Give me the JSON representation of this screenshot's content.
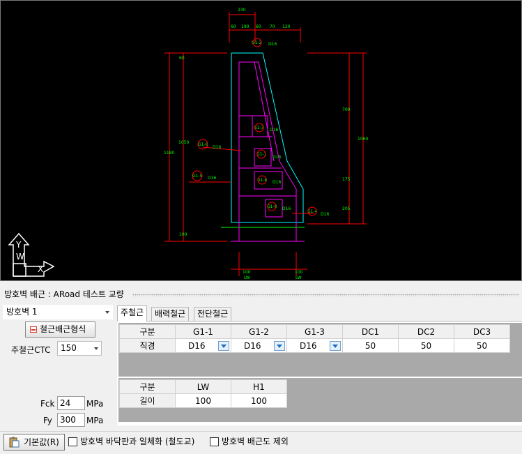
{
  "cad": {
    "dims_top": [
      "230",
      "60",
      "190",
      "60",
      "70",
      "120"
    ],
    "dims_left": [
      "60",
      "1180",
      "1050",
      "100"
    ],
    "dims_right": [
      "700",
      "1060",
      "175",
      "205"
    ],
    "dims_bottom": [
      "100",
      "LW",
      "100",
      "LW"
    ],
    "rebar_tags": [
      "G1-2",
      "D16",
      "G1-3",
      "D16",
      "G1-8",
      "D16",
      "G1-1",
      "D16",
      "G1-9",
      "D16",
      "G1-6",
      "D16",
      "G1-8",
      "D16",
      "G1-4",
      "D16",
      "G1-1",
      "D16",
      "G1-5",
      "D16"
    ],
    "axis_labels": [
      "W",
      "Y",
      "X"
    ]
  },
  "panel": {
    "title": "방호벽 배근 : ARoad 테스트 교량"
  },
  "left": {
    "wall_select": "방호벽 1",
    "rebar_form_button": "철근배근형식",
    "ctc_label": "주철근CTC",
    "ctc_value": "150",
    "fck_label": "Fck",
    "fck_value": "24",
    "fck_unit": "MPa",
    "fy_label": "Fy",
    "fy_value": "300",
    "fy_unit": "MPa"
  },
  "tabs": [
    "주철근",
    "배력철근",
    "전단철근"
  ],
  "main_table": {
    "headers": [
      "구분",
      "G1-1",
      "G1-2",
      "G1-3",
      "DC1",
      "DC2",
      "DC3"
    ],
    "row_label": "직경",
    "values": [
      "D16",
      "D16",
      "D16",
      "50",
      "50",
      "50"
    ]
  },
  "length_table": {
    "headers": [
      "구분",
      "LW",
      "H1"
    ],
    "row_label": "길이",
    "values": [
      "100",
      "100"
    ]
  },
  "bottom": {
    "default_button": "기본값(R)",
    "check1": "방호벽 바닥판과 일체화 (철도교)",
    "check2": "방호벽 배근도 제외"
  },
  "colors": {
    "cad_bg": "#000000",
    "outline_cyan": "#00ffff",
    "rebar_magenta": "#ff00ff",
    "dim_red": "#ff0000",
    "text_green": "#00ff00"
  }
}
